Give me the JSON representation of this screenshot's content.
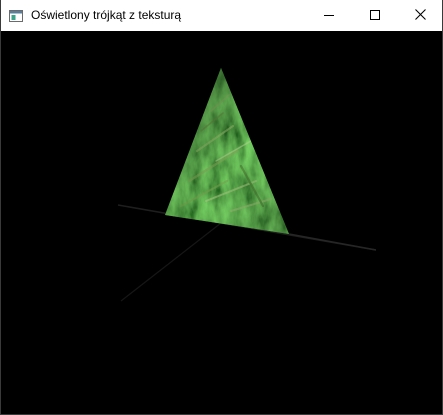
{
  "window": {
    "title": "Oświetlony trójkąt z teksturą",
    "icon": "application-window-icon",
    "controls": {
      "minimize": "minimize-icon",
      "maximize": "maximize-icon",
      "close": "close-icon"
    }
  },
  "scene": {
    "background": "#000000",
    "texture_colors": {
      "dark": "#1e3514",
      "mid": "#3f6a2a",
      "light": "#88b060",
      "highlight": "#c8dca0"
    },
    "axis_color": "#1b1b1b"
  }
}
